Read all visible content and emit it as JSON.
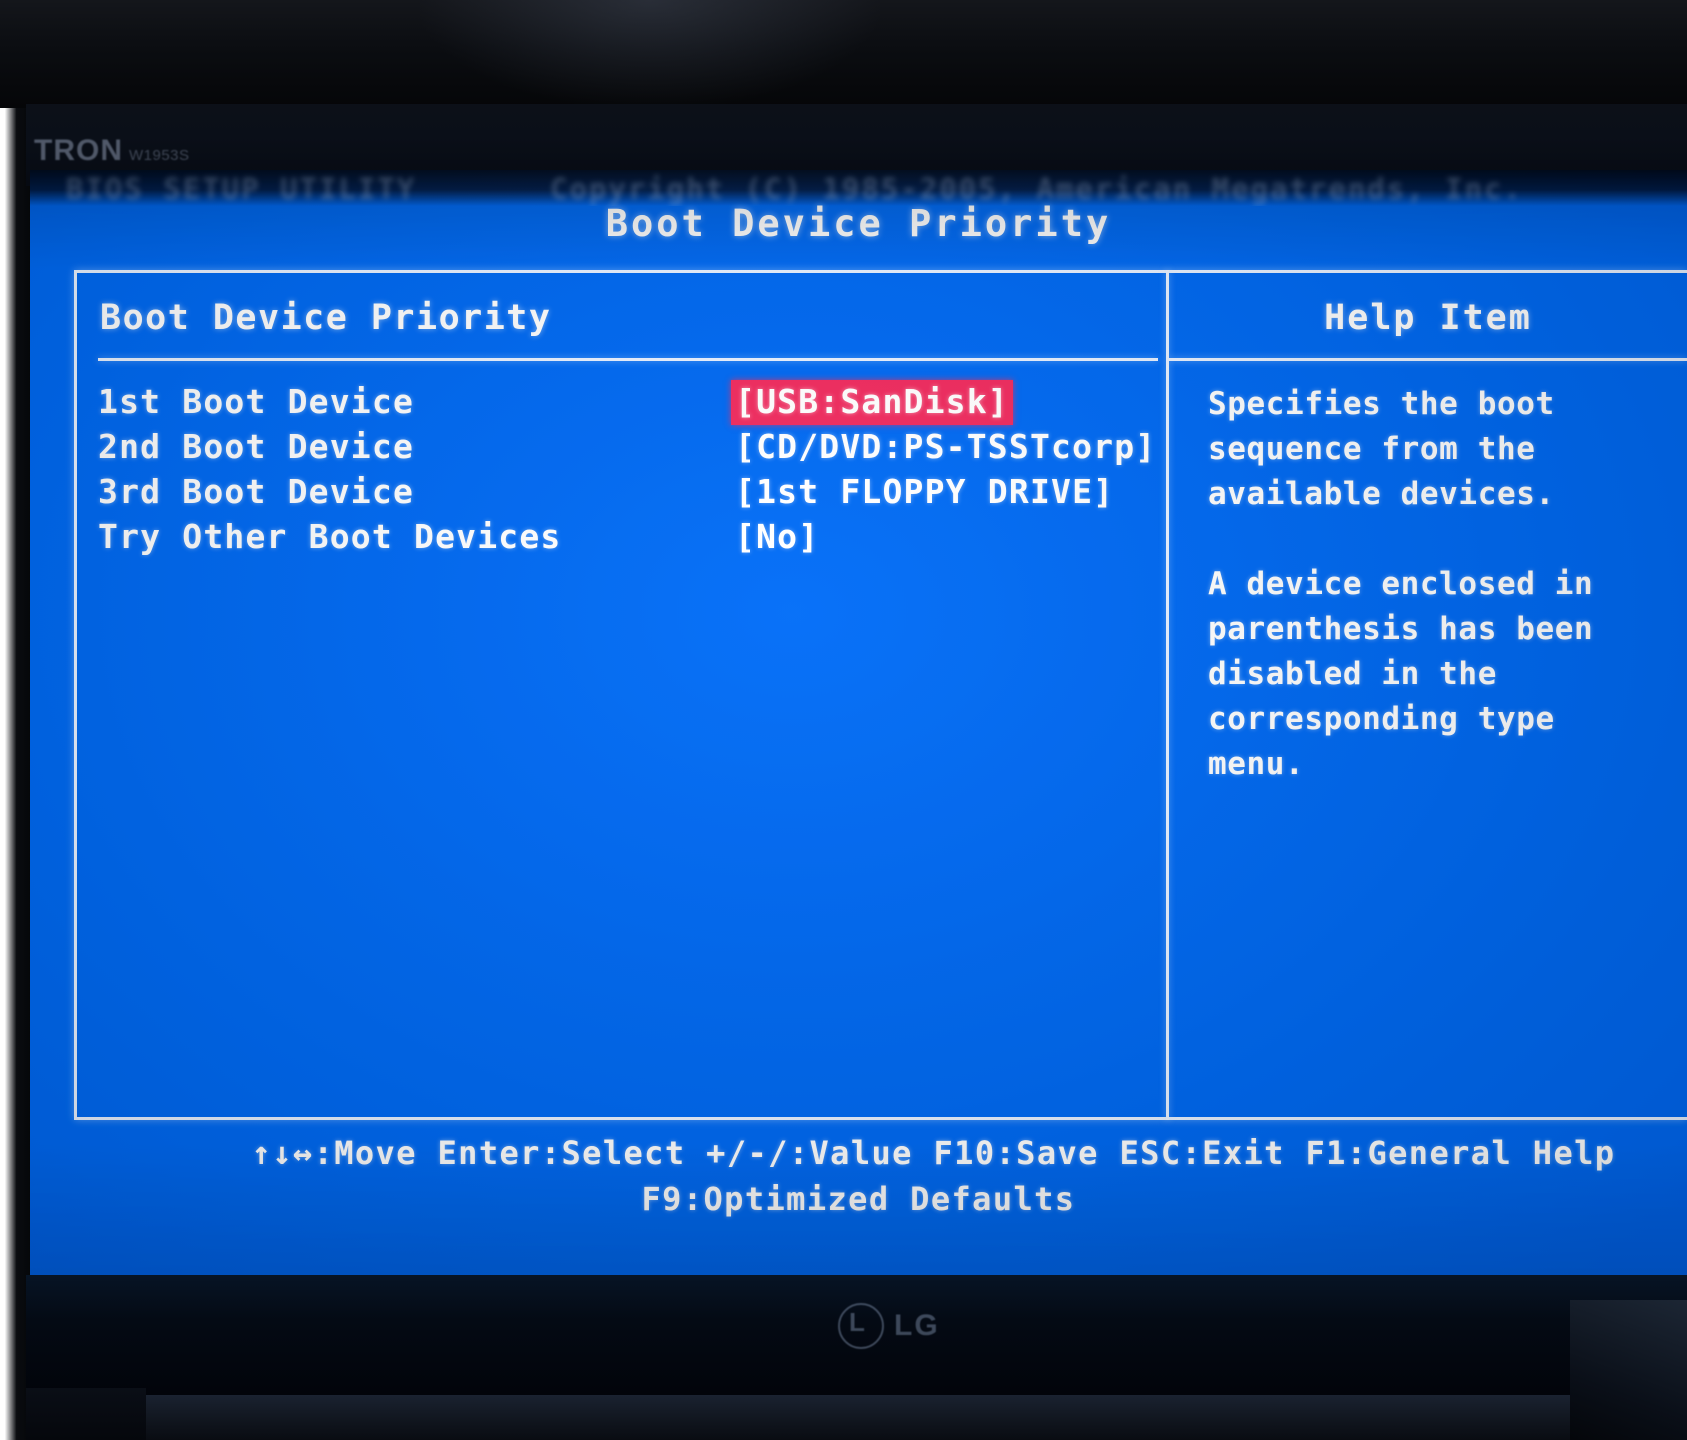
{
  "photo": {
    "monitor_brand_top": "TRON",
    "monitor_model_top": "W1953S",
    "monitor_brand_bottom": "LG"
  },
  "bios": {
    "titlebar_ghost_left": "BIOS SETUP UTILITY",
    "titlebar_ghost_right": "Copyright (C) 1985-2005, American Megatrends, Inc.",
    "page_title": "Boot Device Priority",
    "settings": {
      "pane_title": "Boot Device Priority",
      "rows": [
        {
          "label": "1st Boot Device",
          "value": "[USB:SanDisk]",
          "selected": true
        },
        {
          "label": "2nd Boot Device",
          "value": "[CD/DVD:PS-TSSTcorp]",
          "selected": false
        },
        {
          "label": "3rd Boot Device",
          "value": "[1st FLOPPY DRIVE]",
          "selected": false
        },
        {
          "label": "Try Other Boot Devices",
          "value": "[No]",
          "selected": false
        }
      ]
    },
    "help": {
      "title": "Help Item",
      "lines": [
        "Specifies the boot",
        "sequence from the",
        "available devices.",
        "",
        "A device enclosed in",
        "parenthesis has been",
        "disabled in the",
        "corresponding type",
        "menu."
      ]
    },
    "keybar": {
      "line1": "↑↓↔:Move   Enter:Select   +/-/:Value   F10:Save   ESC:Exit   F1:General Help",
      "line2": "F9:Optimized Defaults"
    },
    "colors": {
      "screen_blue": "#0b69e3",
      "selection_red": "#e0315f",
      "text_white": "#ffffff"
    }
  }
}
